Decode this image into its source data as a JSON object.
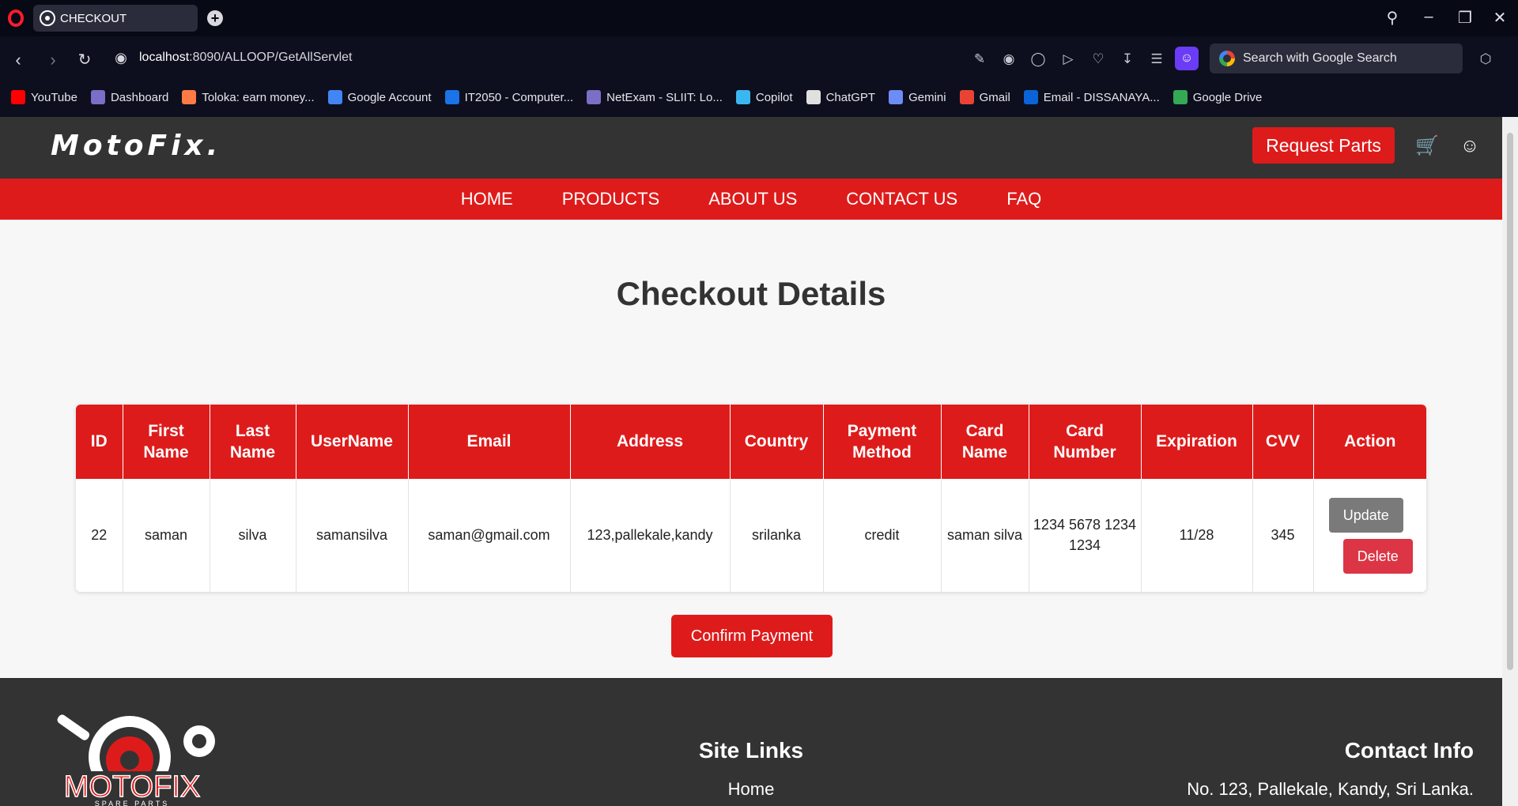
{
  "browser": {
    "tab_title": "CHECKOUT",
    "url_host": "localhost",
    "url_rest": ":8090/ALLOOP/GetAllServlet",
    "search_placeholder": "Search with Google Search",
    "bookmarks": [
      {
        "label": "YouTube",
        "color": "#ff0000"
      },
      {
        "label": "Dashboard",
        "color": "#7b6ec6"
      },
      {
        "label": "Toloka: earn money...",
        "color": "#ff7a45"
      },
      {
        "label": "Google Account",
        "color": "#4285f4"
      },
      {
        "label": "IT2050 - Computer...",
        "color": "#1a73e8"
      },
      {
        "label": "NetExam - SLIIT: Lo...",
        "color": "#7b6ec6"
      },
      {
        "label": "Copilot",
        "color": "#3ab7f0"
      },
      {
        "label": "ChatGPT",
        "color": "#e0e0e0"
      },
      {
        "label": "Gemini",
        "color": "#6d8cf5"
      },
      {
        "label": "Gmail",
        "color": "#ea4335"
      },
      {
        "label": "Email - DISSANAYA...",
        "color": "#0a64d8"
      },
      {
        "label": "Google Drive",
        "color": "#34a853"
      }
    ]
  },
  "site": {
    "logo": "MotoFix.",
    "request_parts": "Request Parts",
    "nav": [
      "HOME",
      "PRODUCTS",
      "ABOUT US",
      "CONTACT US",
      "FAQ"
    ],
    "page_title": "Checkout Details",
    "table": {
      "headers": [
        "ID",
        "First Name",
        "Last Name",
        "UserName",
        "Email",
        "Address",
        "Country",
        "Payment Method",
        "Card Name",
        "Card Number",
        "Expiration",
        "CVV",
        "Action"
      ],
      "row": {
        "id": "22",
        "first_name": "saman",
        "last_name": "silva",
        "username": "samansilva",
        "email": "saman@gmail.com",
        "address": "123,pallekale,kandy",
        "country": "srilanka",
        "payment_method": "credit",
        "card_name": "saman silva",
        "card_number": "1234 5678 1234 1234",
        "expiration": "11/28",
        "cvv": "345"
      },
      "update_label": "Update",
      "delete_label": "Delete"
    },
    "confirm_payment": "Confirm Payment",
    "footer": {
      "logo_text": "MOTOFIX",
      "logo_sub": "SPARE PARTS",
      "site_links_title": "Site Links",
      "home_link": "Home",
      "contact_title": "Contact Info",
      "address": "No. 123, Pallekale, Kandy, Sri Lanka."
    }
  },
  "colors": {
    "brand_red": "#de1b1b",
    "header_dark": "#333333",
    "delete_red": "#dc3545",
    "update_gray": "#7a7a7a"
  }
}
